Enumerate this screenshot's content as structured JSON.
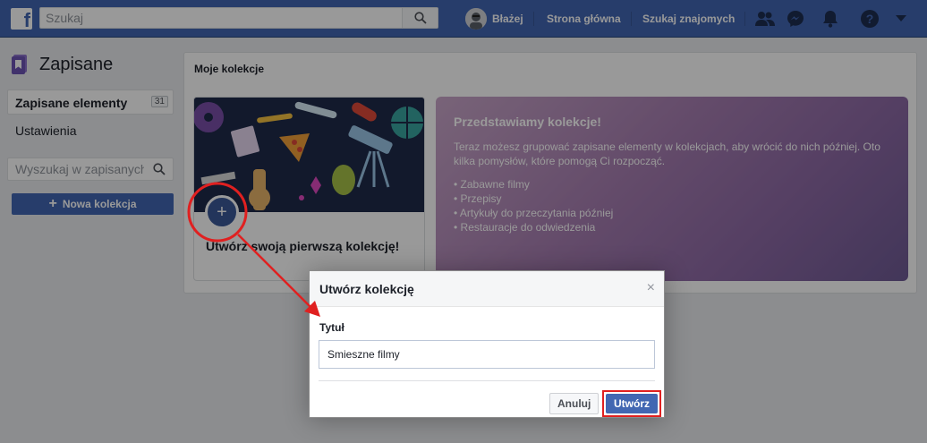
{
  "topbar": {
    "search_placeholder": "Szukaj",
    "user_name": "Błażej",
    "home_label": "Strona główna",
    "find_friends_label": "Szukaj znajomych",
    "logo_letter": "f"
  },
  "sidebar": {
    "title": "Zapisane",
    "items": [
      {
        "label": "Zapisane elementy",
        "count": "31"
      },
      {
        "label": "Ustawienia"
      }
    ],
    "search_placeholder": "Wyszukaj w zapisanych",
    "new_collection_label": "Nowa kolekcja",
    "new_collection_plus": "+"
  },
  "main": {
    "title": "Moje kolekcje",
    "card": {
      "cta": "Utwórz swoją pierwszą kolekcję!",
      "add_symbol": "+"
    },
    "promo": {
      "title": "Przedstawiamy kolekcje!",
      "description": "Teraz możesz grupować zapisane elementy w kolekcjach, aby wrócić do nich później. Oto kilka pomysłów, które pomogą Ci rozpocząć.",
      "ideas": [
        "• Zabawne filmy",
        "• Przepisy",
        "• Artykuły do przeczytania później",
        "• Restauracje do odwiedzenia"
      ]
    }
  },
  "dialog": {
    "title": "Utwórz kolekcję",
    "close_symbol": "×",
    "field_label": "Tytuł",
    "field_value": "Smieszne filmy",
    "cancel_label": "Anuluj",
    "create_label": "Utwórz"
  },
  "colors": {
    "brand": "#4267b2",
    "annotation": "#e02020",
    "promo_start": "#c9a6c9",
    "promo_end": "#6f5b95"
  },
  "icons": [
    "facebook-logo-icon",
    "search-icon",
    "friend-requests-icon",
    "messenger-icon",
    "notifications-icon",
    "help-icon",
    "chevron-down-icon",
    "saved-bookmark-icon",
    "plus-icon",
    "close-icon"
  ]
}
